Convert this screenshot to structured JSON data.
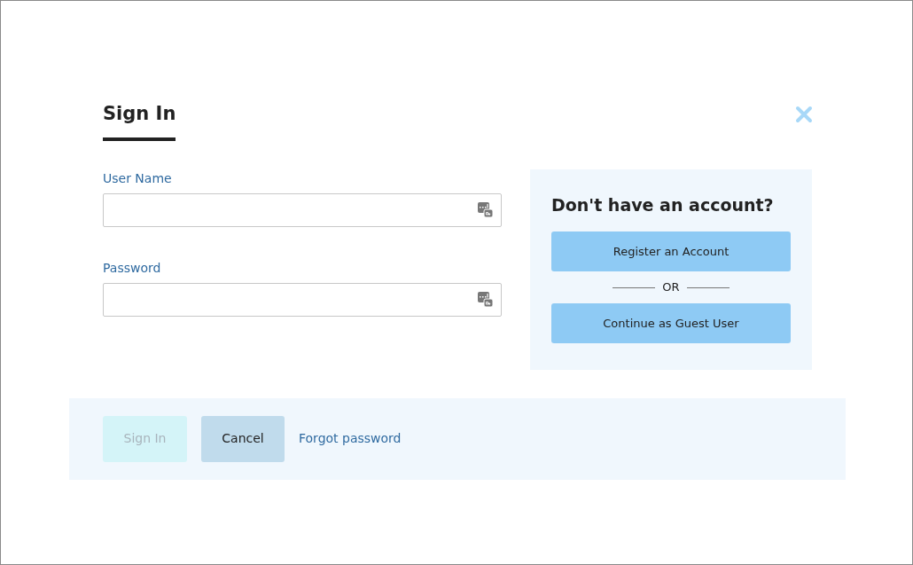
{
  "tabs": [
    {
      "label": "Sign In",
      "selected": true
    }
  ],
  "fields": [
    {
      "label": "User Name"
    },
    {
      "label": "Password"
    }
  ],
  "register_panel": {
    "heading": "Don't have an account?",
    "buttons": [
      "Register an Account",
      "Continue as Guest User"
    ],
    "separator": "OR"
  },
  "footer": {
    "sign_in": {
      "label": "Sign In",
      "disabled": true
    },
    "cancel": "Cancel",
    "forgot_link": "Forgot password"
  }
}
